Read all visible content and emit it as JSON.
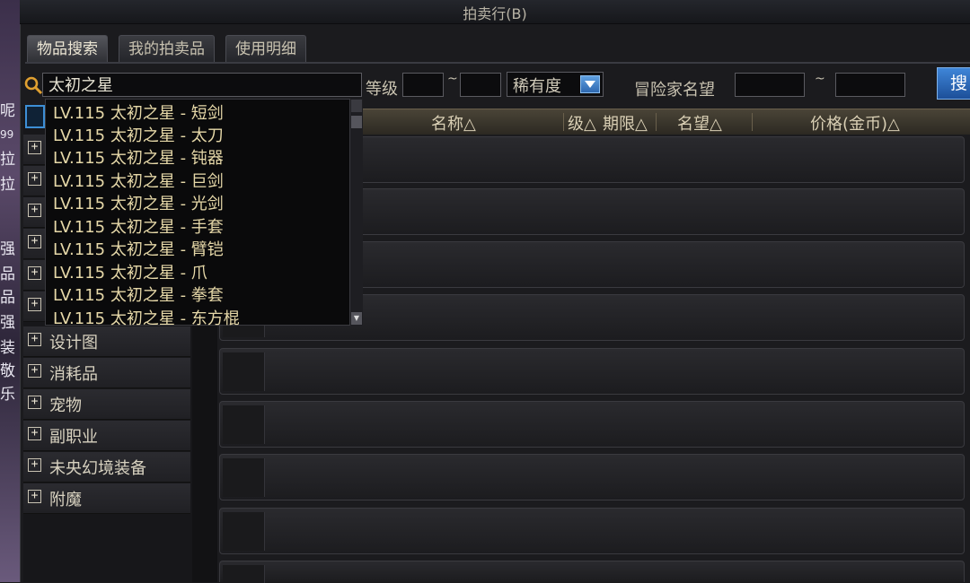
{
  "window": {
    "title": "拍卖行(B)"
  },
  "tabs": [
    {
      "label": "物品搜索",
      "active": true
    },
    {
      "label": "我的拍卖品",
      "active": false
    },
    {
      "label": "使用明细",
      "active": false
    }
  ],
  "search": {
    "query": "太初之星",
    "level_label": "等级",
    "range_sep": "~",
    "rarity_value": "稀有度",
    "adventurer_label": "冒险家名望",
    "button_label": "搜"
  },
  "dropdown_options": [
    "LV.115 太初之星 - 短剑",
    "LV.115 太初之星 - 太刀",
    "LV.115 太初之星 - 钝器",
    "LV.115 太初之星 - 巨剑",
    "LV.115 太初之星 - 光剑",
    "LV.115 太初之星 - 手套",
    "LV.115 太初之星 - 臂铠",
    "LV.115 太初之星 - 爪",
    "LV.115 太初之星 - 拳套",
    "LV.115 太初之星 - 东方棍"
  ],
  "table_headers": {
    "name": "名称△",
    "level": "级△",
    "period": "期限△",
    "fame": "名望△",
    "price": "价格(金币)△"
  },
  "categories": [
    "设计图",
    "消耗品",
    "宠物",
    "副职业",
    "未央幻境装备",
    "附魔"
  ],
  "edge_text": [
    "呢",
    "99",
    "拉",
    "拉",
    "强",
    "品",
    "品",
    "强",
    "装",
    "敬",
    "乐"
  ],
  "colors": {
    "accent_blue": "#3d8fd6",
    "dropdown_text": "#e6d8a8",
    "header_gold": "#d9cfb4"
  }
}
